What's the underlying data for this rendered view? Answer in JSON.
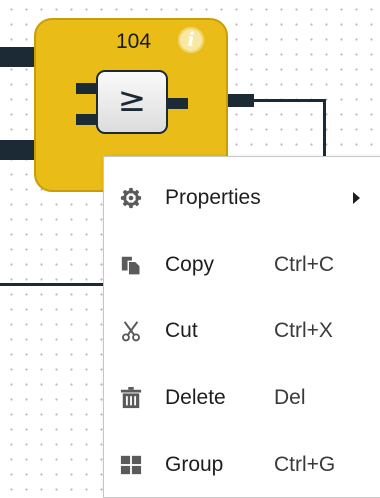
{
  "block": {
    "id": "104",
    "info_icon": "info-icon",
    "gate_symbol": "≥"
  },
  "context_menu": {
    "items": [
      {
        "label": "Properties",
        "shortcut": "",
        "icon": "gear-icon",
        "has_submenu": true
      },
      {
        "label": "Copy",
        "shortcut": "Ctrl+C",
        "icon": "copy-icon"
      },
      {
        "label": "Cut",
        "shortcut": "Ctrl+X",
        "icon": "scissors-icon"
      },
      {
        "label": "Delete",
        "shortcut": "Del",
        "icon": "trash-icon"
      },
      {
        "label": "Group",
        "shortcut": "Ctrl+G",
        "icon": "group-icon"
      }
    ]
  },
  "colors": {
    "block_fill": "#e9bc18",
    "wire": "#1c2a36",
    "menu_icon": "#5a5a5a"
  }
}
